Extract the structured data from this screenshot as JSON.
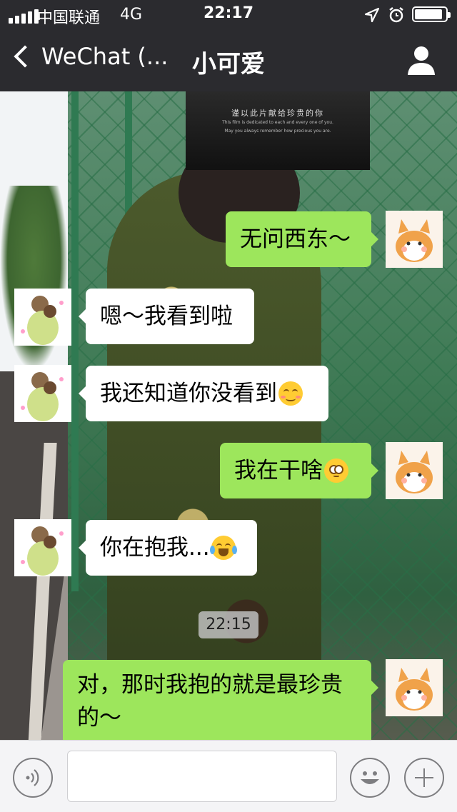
{
  "status_bar": {
    "carrier": "中国联通",
    "network": "4G",
    "time": "22:17",
    "icons": [
      "signal-icon",
      "location-icon",
      "alarm-icon",
      "battery-icon"
    ]
  },
  "nav": {
    "back_label": "WeChat (...",
    "title": "小可爱",
    "right_icon": "profile-icon"
  },
  "background_sign": {
    "line1": "谨以此片献给珍贵的你",
    "line2": "This film is dedicated to each and every one of you.",
    "line3": "May you always remember how precious you are."
  },
  "messages": [
    {
      "side": "out",
      "text": "无问西东～"
    },
    {
      "side": "in",
      "text": "嗯～我看到啦"
    },
    {
      "side": "in",
      "text": "我还知道你没看到",
      "emoji": "grinning-blush-emoji"
    },
    {
      "side": "out",
      "text": "我在干啥",
      "emoji": "flushed-emoji"
    },
    {
      "side": "in",
      "text": "你在抱我...",
      "emoji": "tears-of-joy-emoji"
    },
    {
      "side": "out",
      "text": "对，那时我抱的就是最珍贵的～"
    }
  ],
  "timestamp": "22:15",
  "input_bar": {
    "voice_icon": "voice-icon",
    "text_value": "",
    "emoji_icon": "smiley-icon",
    "plus_icon": "plus-icon"
  },
  "colors": {
    "nav_bg": "#2b2b2f",
    "outgoing_bubble": "#9de65c",
    "incoming_bubble": "#ffffff"
  }
}
